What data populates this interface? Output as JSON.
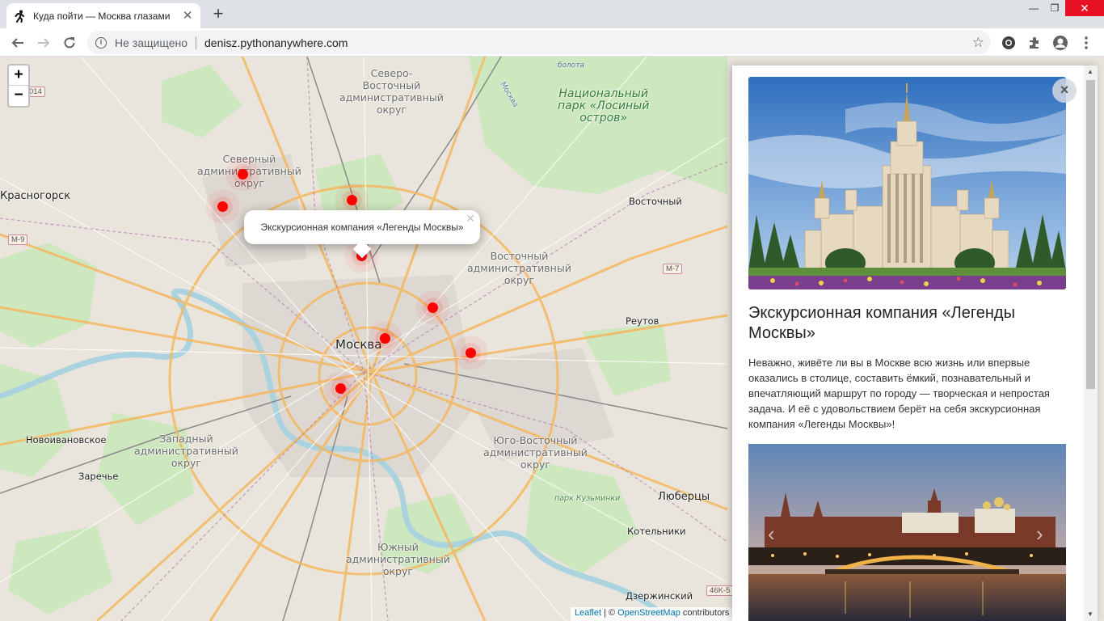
{
  "browser": {
    "tab_title": "Куда пойти — Москва глазами",
    "not_secure": "Не защищено",
    "url": "denisz.pythonanywhere.com"
  },
  "map": {
    "zoom_in": "+",
    "zoom_out": "−",
    "labels": {
      "sever": "Северный\nадминистративный\nокруг",
      "sev_vost": "Северо-\nВосточный\nадминистративный\nокруг",
      "vost": "Восточный\nадминистративный\nокруг",
      "yugo_vost": "Юго-Восточный\nадминистративный\nокруг",
      "yuzh": "Южный\nадминистративный\nокруг",
      "zapad": "Западный\nадминистративный\nокруг",
      "moskva": "Москва",
      "krasnogorsk": "Красногорск",
      "lyubertsy": "Люберцы",
      "novoivanovskoe": "Новоивановское",
      "zarechye": "Заречье",
      "reutov": "Реутов",
      "vostochny": "Восточный",
      "kotelniki": "Котельники",
      "dzerzhinsky": "Дзержинский",
      "park_losiny": "Национальный\nпарк «Лосиный\nостров»",
      "park_kuzminki": "парк Кузьминки",
      "bolota": "болота",
      "moskva_river": "Москва"
    },
    "highways": {
      "m9": "M-9",
      "m7": "M-7",
      "a014": "014",
      "a46k": "46K-5"
    },
    "popup_text": "Экскурсионная компания «Легенды Москвы»",
    "attribution": {
      "leaflet": "Leaflet",
      "osm": "OpenStreetMap",
      "sep": " | © ",
      "contrib": " contributors"
    }
  },
  "sidebar": {
    "title": "Экскурсионная компания «Легенды Москвы»",
    "description": "Неважно, живёте ли вы в Москве всю жизнь или впервые оказались в столице, составить ёмкий, познавательный и впечатляющий маршрут по городу — творческая и непростая задача. И её с удовольствием берёт на себя экскурсионная компания «Легенды Москвы»!",
    "close": "×"
  }
}
